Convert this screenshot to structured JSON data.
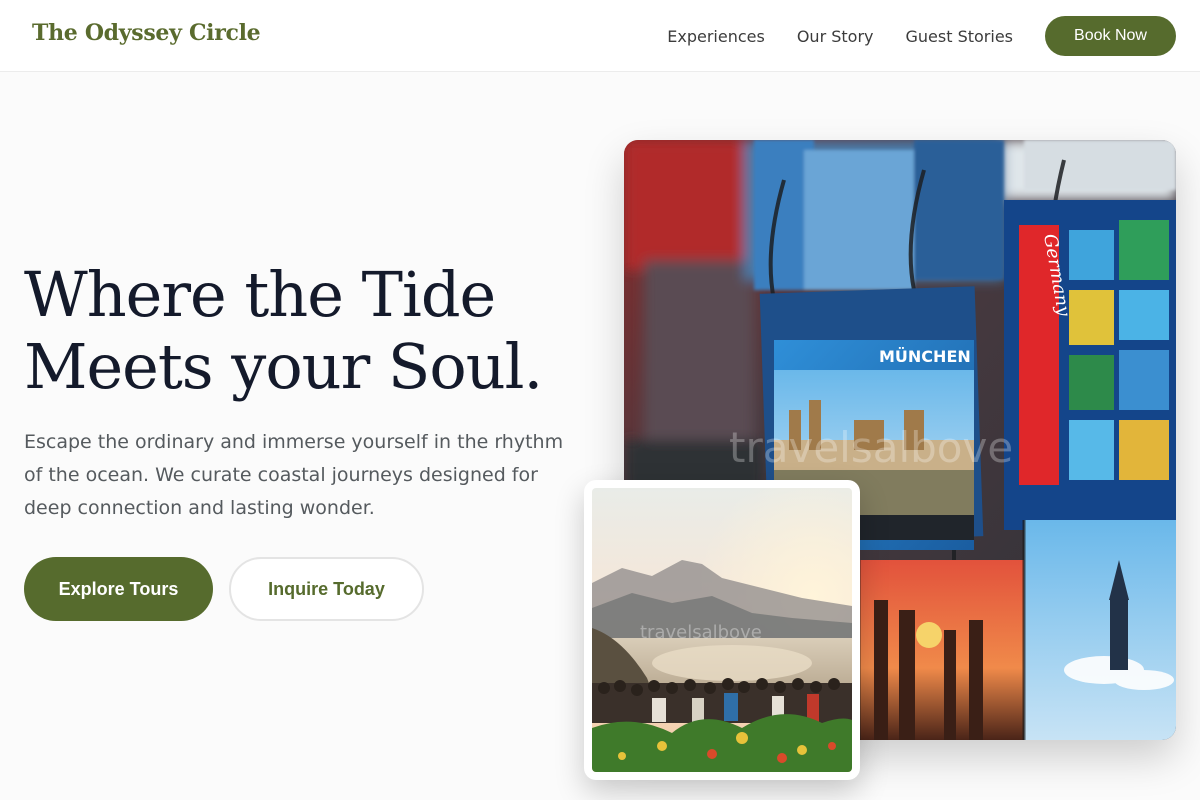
{
  "header": {
    "brand": "The Odyssey Circle",
    "nav": [
      {
        "label": "Experiences"
      },
      {
        "label": "Our Story"
      },
      {
        "label": "Guest Stories"
      }
    ],
    "cta_label": "Book Now"
  },
  "hero": {
    "title_line1": "Where the Tide",
    "title_line2": "Meets your Soul.",
    "subtitle": "Escape the ordinary and immerse yourself in the rhythm of the ocean. We curate coastal journeys designed for deep connection and lasting wonder.",
    "primary_cta": "Explore Tours",
    "secondary_cta": "Inquire Today"
  },
  "images": {
    "main": {
      "postcard_label_1": "MÜNCHEN",
      "postcard_label_2": "Germany",
      "watermark": "travelsalbove"
    },
    "inset": {
      "watermark": "travelsalbove"
    }
  },
  "colors": {
    "accent": "#566b2d",
    "brand_text": "#5a6b2e",
    "title_text": "#141a2b",
    "body_text": "#555a5e"
  }
}
